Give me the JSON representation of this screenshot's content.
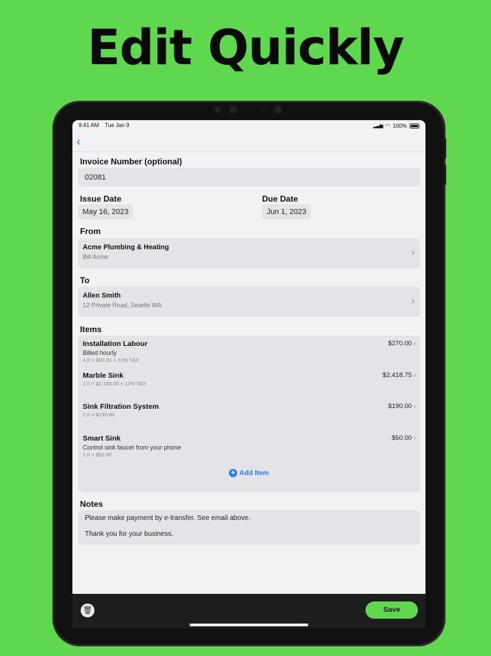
{
  "headline": "Edit Quickly",
  "status": {
    "time": "9:41 AM",
    "date": "Tue Jan 9",
    "battery": "100%"
  },
  "invoice": {
    "label": "Invoice Number (optional)",
    "value": "02081"
  },
  "issue_date": {
    "label": "Issue Date",
    "value": "May 16, 2023"
  },
  "due_date": {
    "label": "Due Date",
    "value": "Jun 1, 2023"
  },
  "from": {
    "label": "From",
    "name": "Acme Plumbing & Heating",
    "sub": "Bill Acme"
  },
  "to": {
    "label": "To",
    "name": "Allen Smith",
    "sub": "12 Private Road, Seattle WA"
  },
  "items": {
    "label": "Items",
    "list": [
      {
        "name": "Installation Labour",
        "desc": "Billed hourly",
        "meta": "4.0 × $60.00 + 12% TAX",
        "price": "$270.00"
      },
      {
        "name": "Marble Sink",
        "desc": "",
        "meta": "1.0 × $2,150.00 + 12% TAX",
        "price": "$2,418.75"
      },
      {
        "name": "Sink Filtration System",
        "desc": "",
        "meta": "1.0 × $190.00",
        "price": "$190.00"
      },
      {
        "name": "Smart Sink",
        "desc": "Control sink faucet from your phone",
        "meta": "1.0 × $50.00",
        "price": "$50.00"
      }
    ],
    "add_label": "Add Item"
  },
  "notes": {
    "label": "Notes",
    "line1": "Please make payment by e-transfer. See email above.",
    "line2": "Thank you for your business."
  },
  "toolbar": {
    "save_label": "Save"
  },
  "colors": {
    "background": "#5fd84f",
    "accent": "#2f7bf5",
    "save": "#5fd84f"
  }
}
